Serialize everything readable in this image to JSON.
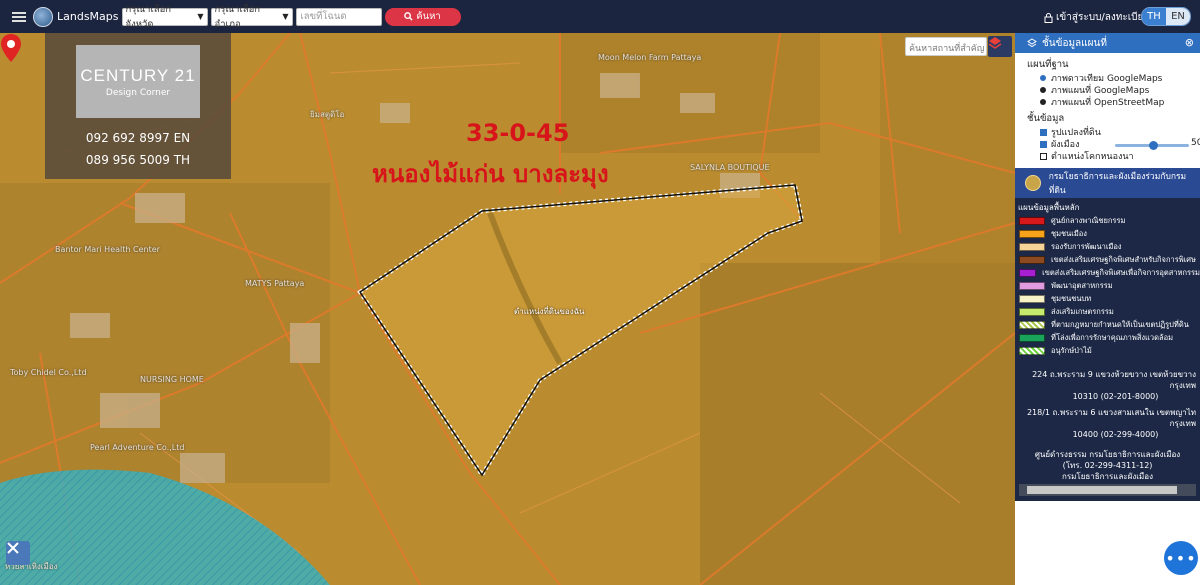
{
  "app": {
    "brand": "LandsMaps"
  },
  "topbar": {
    "province_select": "กรุณาเลือกจังหวัด",
    "district_select": "กรุณาเลือกอำเภอ",
    "deed_placeholder": "เลขที่โฉนด",
    "search_label": "ค้นหา",
    "login_label": "เข้าสู่ระบบ/ลงทะเบียน",
    "lang_th": "TH",
    "lang_en": "EN"
  },
  "map": {
    "agent": {
      "logo_line1": "CENTURY 21",
      "logo_line2": "Design Corner",
      "phone_en": "092 692 8997 EN",
      "phone_th": "089 956 5009 TH"
    },
    "plot_size": "33-0-45",
    "plot_location": "หนองไม้แก่น บางละมุง",
    "place_search_placeholder": "ค้นหาสถานที่สำคัญ",
    "pin_label": "ตำแหน่งที่ดินของฉัน",
    "labels": [
      "Moon Melon Farm Pattaya",
      "ยิมสตูดิโอ",
      "SALYNLA BOUTIQUE",
      "Bantor Mari Health Center",
      "MATYS Pattaya",
      "NURSING HOME",
      "Pearl Adventure Co.,Ltd",
      "Toby Chidel Co.,Ltd",
      "ห้วยสาเหิงเมือง"
    ]
  },
  "panel": {
    "title": "ชั้นข้อมูลแผนที่",
    "basemap_heading": "แผนที่ฐาน",
    "basemaps": [
      "ภาพดาวเทียม GoogleMaps",
      "ภาพแผนที่ GoogleMaps",
      "ภาพแผนที่ OpenStreetMap"
    ],
    "selected_basemap": "ภาพดาวเทียม GoogleMaps",
    "layers_heading": "ชั้นข้อมูล",
    "layers": [
      {
        "label": "รูปแปลงที่ดิน",
        "checked": true
      },
      {
        "label": "ผังเมือง",
        "checked": true
      },
      {
        "label": "ตำแหน่งโคกหนองนา",
        "checked": false
      }
    ],
    "opacity_percent": "50%",
    "org_name": "กรมโยธาธิการและผังเมืองร่วมกับกรมที่ดิน",
    "legend_title": "แผนข้อมูลพื้นหลัก",
    "legend": [
      {
        "label": "ศูนย์กลางพาณิชยกรรม",
        "color": "#d7191c"
      },
      {
        "label": "ชุมชนเมือง",
        "color": "#f6a21a"
      },
      {
        "label": "รองรับการพัฒนาเมือง",
        "color": "#f5d49a"
      },
      {
        "label": "เขตส่งเสริมเศรษฐกิจพิเศษสำหรับกิจการพิเศษ",
        "color": "#8b4a1f"
      },
      {
        "label": "เขตส่งเสริมเศรษฐกิจพิเศษเพื่อกิจการอุตสาหกรรม",
        "color": "#a61fd1"
      },
      {
        "label": "พัฒนาอุตสาหกรรม",
        "color": "#e39be0"
      },
      {
        "label": "ชุมชนชนบท",
        "color": "#f7f2c8"
      },
      {
        "label": "ส่งเสริมเกษตรกรรม",
        "color": "#c6ea6e"
      },
      {
        "label": "ที่ตามกฎหมายกำหนดให้เป็นเขตปฏิรูปที่ดิน",
        "color": "#a8c84a"
      },
      {
        "label": "ที่โล่งเพื่อการรักษาคุณภาพสิ่งแวดล้อม",
        "color": "#1aa35a"
      },
      {
        "label": "อนุรักษ์ป่าไม้",
        "color": "#6bd13f"
      }
    ],
    "address1": "224 ถ.พระราม 9 แขวงห้วยขวาง เขตห้วยขวาง กรุงเทพ",
    "address1b": "10310 (02-201-8000)",
    "address2": "218/1 ถ.พระราม 6 แขวงสามเสนใน เขตพญาไท กรุงเทพ",
    "address2b": "10400 (02-299-4000)",
    "center1": "ศูนย์ดำรงธรรม กรมโยธาธิการและผังเมือง",
    "center2": "(โทร. 02-299-4311-12)",
    "center3": "กรมโยธาธิการและผังเมือง"
  },
  "colors": {
    "accent": "#2f6fc0",
    "search_button": "#dc3545",
    "plot_text": "#d8141b",
    "topbar": "#1c2540"
  }
}
